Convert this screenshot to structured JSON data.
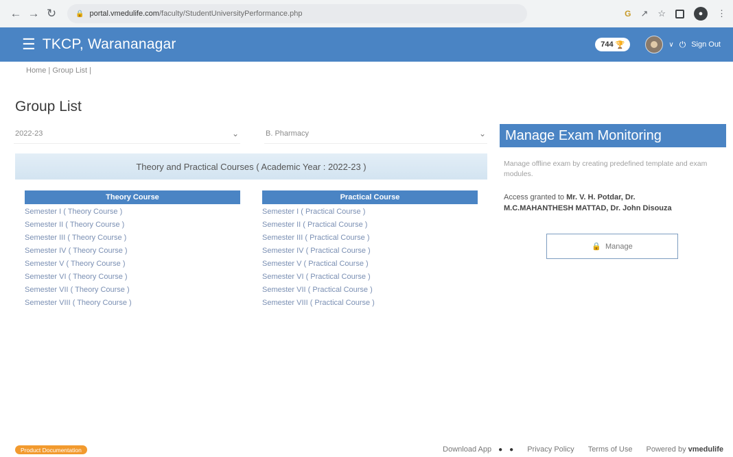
{
  "browser": {
    "url_host": "portal.vmedulife.com",
    "url_path": "/faculty/StudentUniversityPerformance.php"
  },
  "header": {
    "title": "TKCP, Warananagar",
    "points": "744",
    "signout": "Sign Out"
  },
  "breadcrumb": {
    "home": "Home",
    "separator": "|",
    "current": "Group List"
  },
  "page_title": "Group List",
  "filters": {
    "year": "2022-23",
    "program": "B. Pharmacy"
  },
  "banner": "Theory and Practical Courses ( Academic Year : 2022-23 )",
  "theory": {
    "heading": "Theory Course",
    "items": [
      "Semester I ( Theory Course )",
      "Semester II ( Theory Course )",
      "Semester III ( Theory Course )",
      "Semester IV ( Theory Course )",
      "Semester V ( Theory Course )",
      "Semester VI ( Theory Course )",
      "Semester VII ( Theory Course )",
      "Semester VIII ( Theory Course )"
    ]
  },
  "practical": {
    "heading": "Practical Course",
    "items": [
      "Semester I ( Practical Course )",
      "Semester II ( Practical Course )",
      "Semester III ( Practical Course )",
      "Semester IV ( Practical Course )",
      "Semester V ( Practical Course )",
      "Semester VI ( Practical Course )",
      "Semester VII ( Practical Course )",
      "Semester VIII ( Practical Course )"
    ]
  },
  "exam": {
    "title": "Manage Exam Monitoring",
    "description": "Manage offline exam by creating predefined template and exam modules.",
    "access_prefix": "Access granted to",
    "access_names": "Mr. V. H. Potdar, Dr. M.C.MAHANTHESH MATTAD, Dr. John Disouza",
    "manage_label": "Manage"
  },
  "footer": {
    "documentation": "Product Documentation",
    "download_app": "Download App",
    "privacy": "Privacy Policy",
    "terms": "Terms of Use",
    "powered_by": "Powered by",
    "brand": "vmedulife"
  },
  "colors": {
    "primary": "#4a84c4",
    "badge": "#f29a2e",
    "link": "#7a8fb3"
  }
}
